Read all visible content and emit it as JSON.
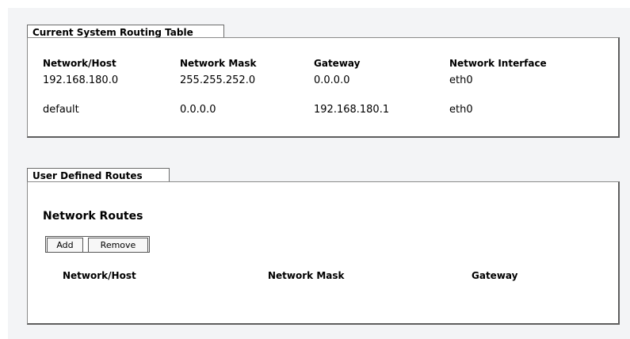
{
  "routing_table": {
    "tab_label": "Current System Routing Table",
    "headers": [
      "Network/Host",
      "Network Mask",
      "Gateway",
      "Network Interface"
    ],
    "rows": [
      [
        "192.168.180.0",
        "255.255.252.0",
        "0.0.0.0",
        "eth0"
      ],
      [
        "default",
        "0.0.0.0",
        "192.168.180.1",
        "eth0"
      ]
    ]
  },
  "user_routes": {
    "tab_label": "User Defined Routes",
    "section_title": "Network Routes",
    "add_label": "Add",
    "remove_label": "Remove",
    "headers": [
      "Network/Host",
      "Network Mask",
      "Gateway"
    ]
  }
}
